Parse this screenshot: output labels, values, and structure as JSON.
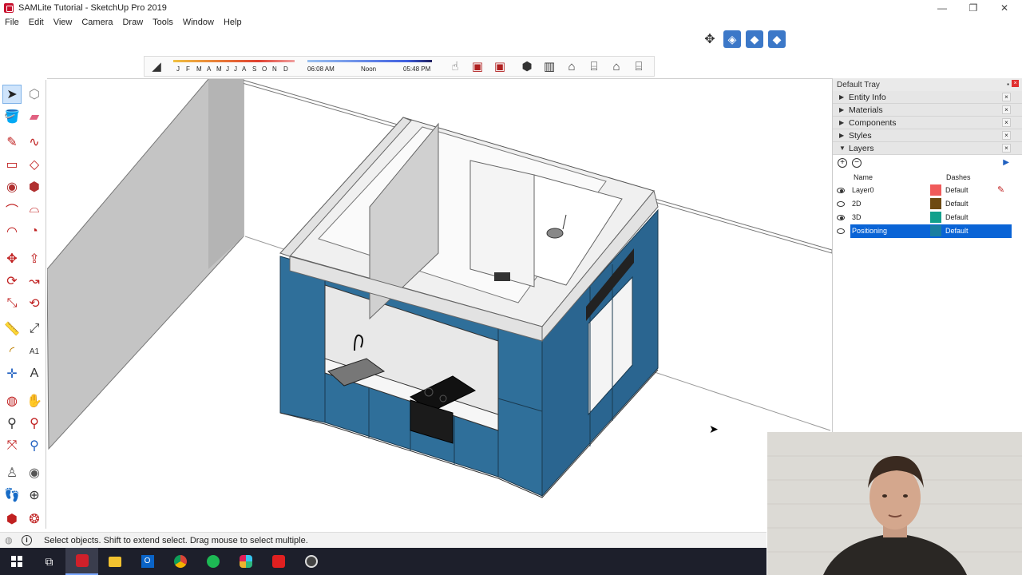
{
  "window": {
    "title": "SAMLite Tutorial - SketchUp Pro 2019",
    "controls": [
      "—",
      "❐",
      "✕"
    ]
  },
  "menu": [
    "File",
    "Edit",
    "View",
    "Camera",
    "Draw",
    "Tools",
    "Window",
    "Help"
  ],
  "shadows": {
    "months": [
      "J",
      "F",
      "M",
      "A",
      "M",
      "J",
      "J",
      "A",
      "S",
      "O",
      "N",
      "D"
    ],
    "time_start": "06:08 AM",
    "time_mid": "Noon",
    "time_end": "05:48 PM"
  },
  "tray": {
    "title": "Default Tray",
    "panels": [
      "Entity Info",
      "Materials",
      "Components",
      "Styles",
      "Layers"
    ],
    "layers": {
      "headers": {
        "name": "Name",
        "dashes": "Dashes"
      },
      "rows": [
        {
          "name": "Layer0",
          "color": "#f05a5a",
          "dashes": "Default",
          "visible": true,
          "selected": false
        },
        {
          "name": "2D",
          "color": "#6e4a12",
          "dashes": "Default",
          "visible": false,
          "selected": false
        },
        {
          "name": "3D",
          "color": "#12a08c",
          "dashes": "Default",
          "visible": true,
          "selected": false
        },
        {
          "name": "Positioning",
          "color": "#1a7fa0",
          "dashes": "Default",
          "visible": false,
          "selected": true
        }
      ]
    }
  },
  "status": {
    "message": "Select objects. Shift to extend select. Drag mouse to select multiple."
  },
  "colors": {
    "cabinet": "#2f6f9a",
    "selection": "#0a64d6",
    "taskbar": "#1d1f2b"
  }
}
